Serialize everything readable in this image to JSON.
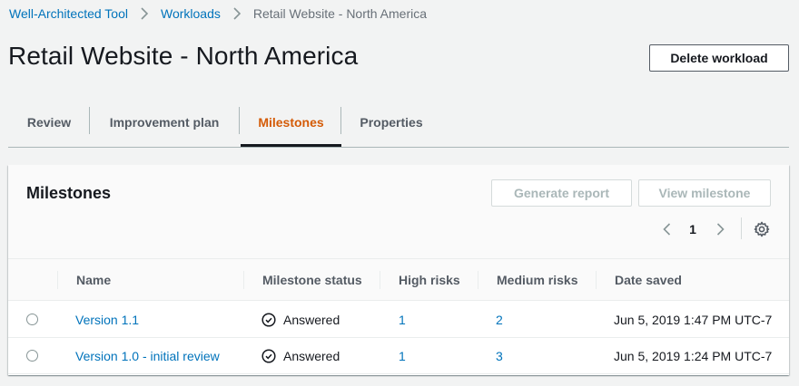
{
  "breadcrumb": {
    "items": [
      "Well-Architected Tool",
      "Workloads"
    ],
    "current": "Retail Website - North America"
  },
  "page": {
    "title": "Retail Website - North America",
    "delete_button": "Delete workload"
  },
  "tabs": [
    {
      "label": "Review"
    },
    {
      "label": "Improvement plan"
    },
    {
      "label": "Milestones",
      "active": true
    },
    {
      "label": "Properties"
    }
  ],
  "milestones": {
    "title": "Milestones",
    "generate_button": "Generate report",
    "view_button": "View milestone",
    "page_number": "1",
    "columns": [
      "Name",
      "Milestone status",
      "High risks",
      "Medium risks",
      "Date saved"
    ],
    "rows": [
      {
        "name": "Version 1.1",
        "status": "Answered",
        "high": "1",
        "medium": "2",
        "date": "Jun 5, 2019 1:47 PM UTC-7"
      },
      {
        "name": "Version 1.0 - initial review",
        "status": "Answered",
        "high": "1",
        "medium": "3",
        "date": "Jun 5, 2019 1:24 PM UTC-7"
      }
    ]
  },
  "colors": {
    "link": "#0073bb",
    "active_tab": "#d45b07",
    "text": "#16191f",
    "muted": "#545b64"
  }
}
